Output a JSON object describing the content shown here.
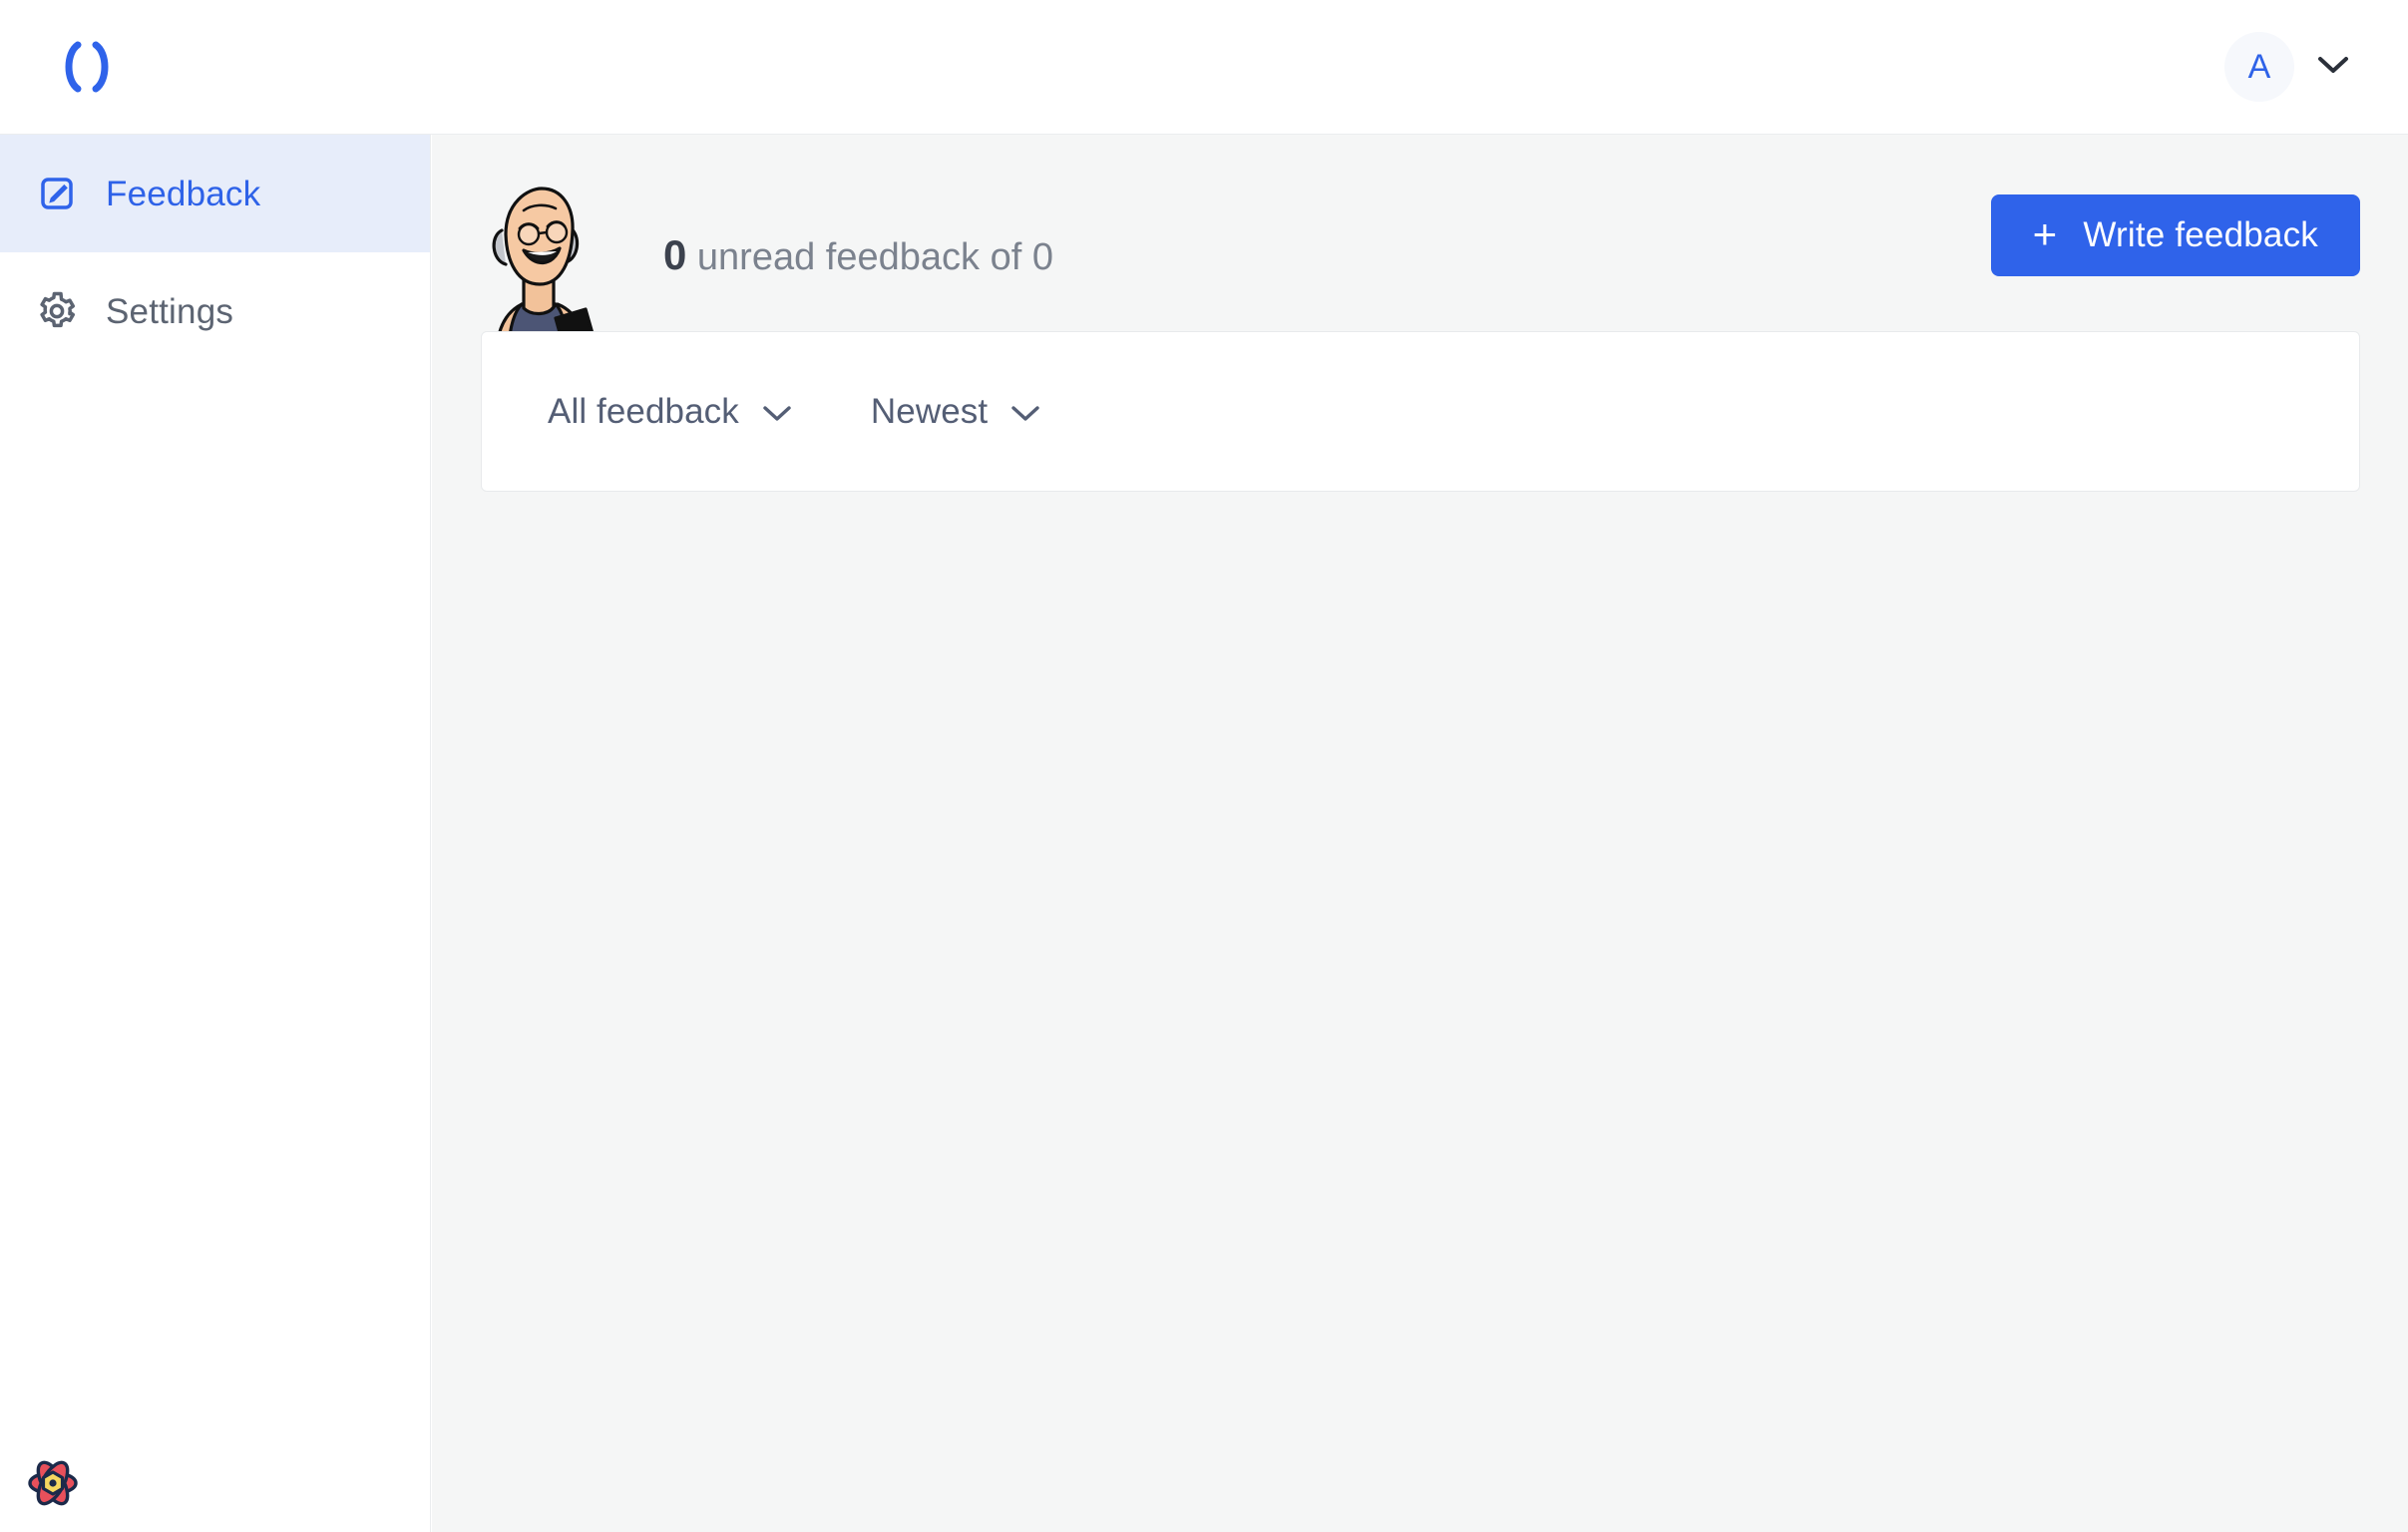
{
  "brand": {
    "logo_icon": "parentheses-logo",
    "accent_color": "#2f63ea"
  },
  "topbar": {
    "account": {
      "avatar_initial": "A",
      "avatar_icon": "avatar",
      "caret_icon": "chevron-down-icon"
    }
  },
  "sidebar": {
    "items": [
      {
        "label": "Feedback",
        "icon": "pencil-square-icon",
        "active": true
      },
      {
        "label": "Settings",
        "icon": "gear-icon",
        "active": false
      }
    ]
  },
  "devtools": {
    "badge_icon": "react-flower-badge-icon"
  },
  "main": {
    "hero_illustration_icon": "cartoon-man-with-phone-illustration",
    "count": {
      "unread": "0",
      "middle_text": " unread feedback of ",
      "total": "0"
    },
    "write_feedback_button": {
      "label": "Write feedback",
      "plus_icon": "plus-icon",
      "color": "#2f63ea"
    },
    "filters": [
      {
        "label": "All feedback",
        "caret_icon": "chevron-down-icon"
      },
      {
        "label": "Newest",
        "caret_icon": "chevron-down-icon"
      }
    ]
  },
  "colors": {
    "accent": "#2f63ea",
    "active_nav_bg": "#e7edfa",
    "page_bg": "#f5f6f6",
    "muted_text": "#7b828e"
  }
}
